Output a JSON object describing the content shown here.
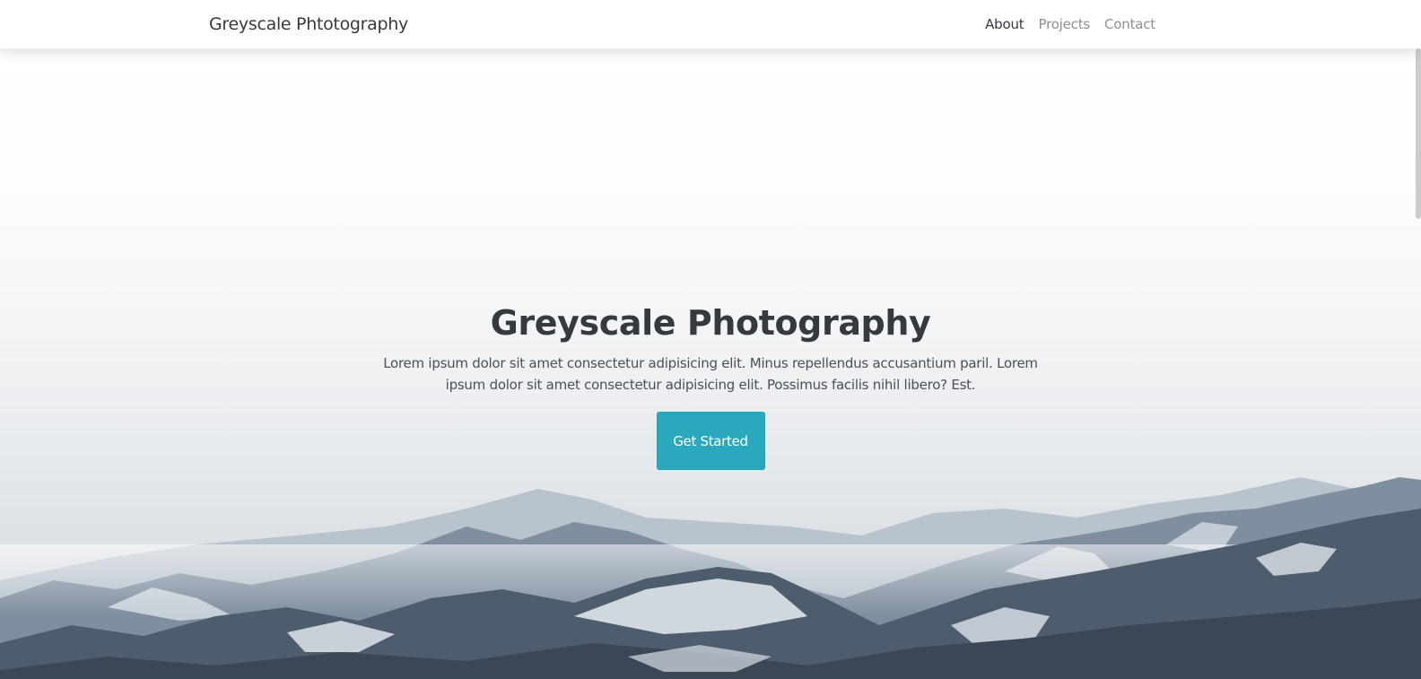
{
  "navbar": {
    "brand": "Greyscale Phtotography",
    "links": [
      "About",
      "Projects",
      "Contact"
    ],
    "active_link": "About"
  },
  "hero": {
    "title": "Greyscale Photography",
    "text": "Lorem ipsum dolor sit amet consectetur adipisicing elit. Minus repellendus accusantium paril. Lorem ipsum dolor sit amet consectetur adipisicing elit. Possimus facilis nihil libero? Est.",
    "button_label": "Get Started"
  },
  "colors": {
    "accent": "#2aa9be",
    "text_dark": "#343a40",
    "text_muted": "#8a8f94"
  }
}
